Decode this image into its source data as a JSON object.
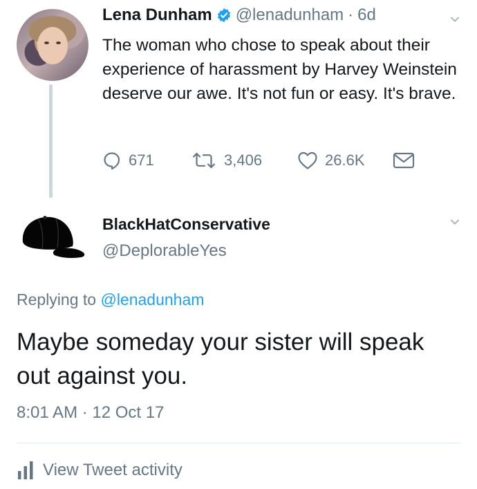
{
  "tweet": {
    "author_name": "Lena Dunham",
    "handle": "@lenadunham",
    "separator": "·",
    "time_ago": "6d",
    "text": "The woman who chose to speak about their experience of harassment by Harvey Weinstein deserve our awe. It's not fun or easy. It's brave.",
    "actions": {
      "replies": "671",
      "retweets": "3,406",
      "likes": "26.6K"
    }
  },
  "reply": {
    "author_name": "BlackHatConservative",
    "handle": "@DeplorableYes",
    "replying_prefix": "Replying to ",
    "replying_handle": "@lenadunham",
    "text": "Maybe someday your sister will speak out against you.",
    "timestamp": "8:01 AM · 12 Oct 17",
    "view_activity": "View Tweet activity"
  },
  "colors": {
    "text": "#14171a",
    "secondary": "#657786",
    "link": "#1da1f2",
    "verified": "#1da1f2"
  },
  "icons": [
    "verified-badge-icon",
    "chevron-down-icon",
    "reply-icon",
    "retweet-icon",
    "like-icon",
    "dm-icon",
    "activity-bars-icon"
  ]
}
